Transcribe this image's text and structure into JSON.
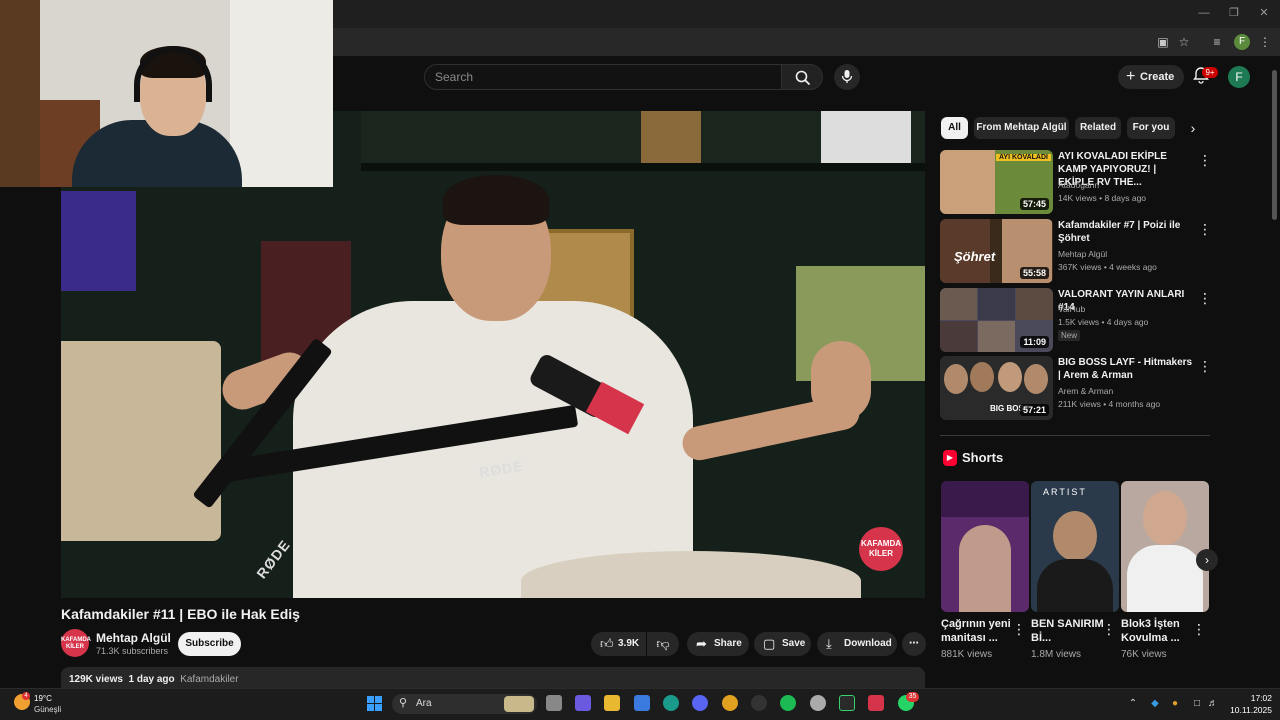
{
  "browser": {
    "colors": {
      "titlebar": "#1f1f1f",
      "toolbar": "#282828"
    },
    "profile_initial": "F"
  },
  "header": {
    "search_placeholder": "Search",
    "create_label": "Create",
    "notification_count": "9+",
    "avatar_initial": "F"
  },
  "video": {
    "title": "Kafamdakiler #11 | EBO ile Hak Ediş",
    "channel_name": "Mehtap Algül",
    "subscribers": "71.3K subscribers",
    "channel_avatar_text": "KAFAMDA KİLER",
    "watermark_text": "KAFAMDA KİLER",
    "mic_brand": "RØDE",
    "subscribe_label": "Subscribe",
    "likes": "3.9K",
    "share_label": "Share",
    "save_label": "Save",
    "download_label": "Download",
    "views": "129K views",
    "age": "1 day ago",
    "tag": "Kafamdakiler"
  },
  "chips": [
    "All",
    "From Mehtap Algül",
    "Related",
    "For you"
  ],
  "recommendations": [
    {
      "title": "AYI KOVALADI EKİPLE KAMP YAPIYORUZ! | EKİPLE RV THE...",
      "channel": "Atadogann",
      "meta": "14K views • 8 days ago",
      "duration": "57:45",
      "thumb_color": "#6b8a3a",
      "thumb_text": "AYI KOVALADI"
    },
    {
      "title": "Kafamdakiler #7 | Poizi ile Şöhret",
      "channel": "Mehtap Algül",
      "meta": "367K views • 4 weeks ago",
      "duration": "55:58",
      "thumb_color": "#3a2a1c",
      "thumb_text": "Şöhret"
    },
    {
      "title": "VALORANT YAYIN ANLARI #14",
      "channel": "ValHub",
      "meta": "1.5K views • 4 days ago",
      "duration": "11:09",
      "badge": "New",
      "thumb_color": "#4a4a5a",
      "thumb_text": ""
    },
    {
      "title": "BIG BOSS LAYF - Hitmakers | Arem & Arman",
      "channel": "Arem & Arman",
      "meta": "211K views • 4 months ago",
      "duration": "57:21",
      "thumb_color": "#2a2a2a",
      "thumb_text": "BIG BOSS"
    }
  ],
  "shorts": {
    "heading": "Shorts",
    "items": [
      {
        "title": "Çağrının yeni manitası ...",
        "views": "881K views",
        "color": "#5a2a6a"
      },
      {
        "title": "BEN SANIRIM Bİ...",
        "views": "1.8M views",
        "color": "#2a3a4a",
        "label": "ARTIST"
      },
      {
        "title": "Blok3 İşten Kovulma ...",
        "views": "76K views",
        "color": "#b8a8a0"
      }
    ]
  },
  "taskbar": {
    "weather_temp": "19°C",
    "weather_desc": "Güneşli",
    "weather_badge": "4",
    "search_label": "Ara",
    "whatsapp_badge": "35",
    "time": "17:02",
    "date": "10.11.2025"
  }
}
